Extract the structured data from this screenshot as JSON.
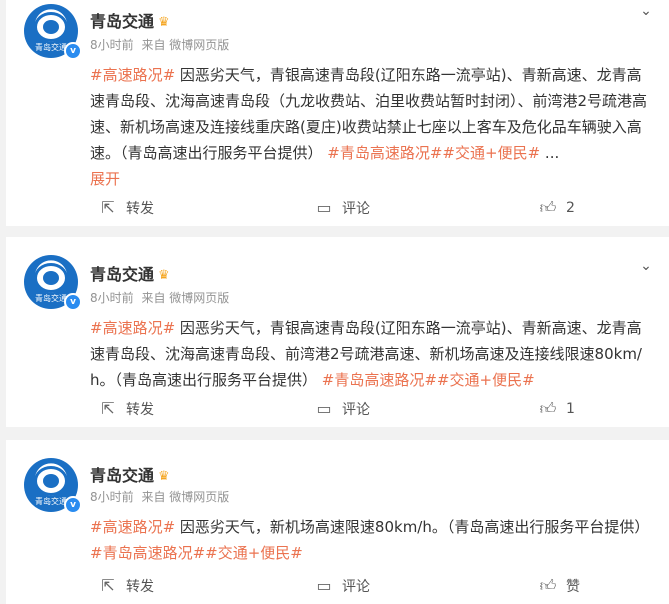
{
  "posts": [
    {
      "author": "青岛交通",
      "avatar_text": "青岛交通",
      "time": "8小时前",
      "source": "来自 微博网页版",
      "tag_topic": "#高速路况#",
      "body": "因恶劣天气，青银高速青岛段(辽阳东路一流亭站)、青新高速、龙青高速青岛段、沈海高速青岛段（九龙收费站、泊里收费站暂时封闭）、前湾港2号疏港高速、新机场高速及连接线重庆路(夏庄)收费站禁止七座以上客车及危化品车辆驶入高速。（青岛高速出行服务平台提供）",
      "tail_tags": "#青岛高速路况##交通+便民#",
      "ellipsis": "...",
      "expand": "展开",
      "share_label": "转发",
      "comment_label": "评论",
      "like_label": "2"
    },
    {
      "author": "青岛交通",
      "avatar_text": "青岛交通",
      "time": "8小时前",
      "source": "来自 微博网页版",
      "tag_topic": "#高速路况#",
      "body": "因恶劣天气，青银高速青岛段(辽阳东路一流亭站)、青新高速、龙青高速青岛段、沈海高速青岛段、前湾港2号疏港高速、新机场高速及连接线限速80km/h。（青岛高速出行服务平台提供）",
      "tail_tags": "#青岛高速路况##交通+便民#",
      "share_label": "转发",
      "comment_label": "评论",
      "like_label": "1"
    },
    {
      "author": "青岛交通",
      "avatar_text": "青岛交通",
      "time": "8小时前",
      "source": "来自 微博网页版",
      "tag_topic": "#高速路况#",
      "body": "因恶劣天气，新机场高速限速80km/h。（青岛高速出行服务平台提供）",
      "tail_tags": "#青岛高速路况##交通+便民#",
      "share_label": "转发",
      "comment_label": "评论",
      "like_label": "赞"
    }
  ],
  "icons": {
    "more": "chevron-down-icon",
    "share": "share-icon",
    "comment": "comment-icon",
    "like": "thumbs-up-icon",
    "verified": "verified-badge-icon",
    "crown": "crown-icon"
  },
  "colors": {
    "accent": "#eb7350",
    "verified": "#2a8cf0",
    "avatar": "#1a6fc4"
  }
}
